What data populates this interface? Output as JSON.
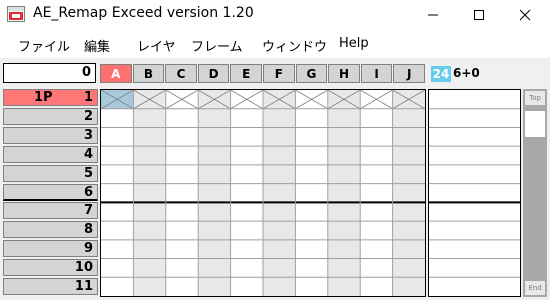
{
  "window": {
    "title": "AE_Remap Exceed version 1.20",
    "icon": "app-icon",
    "controls": [
      "minimize-icon",
      "maximize-icon",
      "close-icon"
    ]
  },
  "menu": [
    "ファイル",
    "編集",
    "レイヤ",
    "フレーム",
    "ウィンドウ",
    "Help"
  ],
  "toolbar": {
    "frame_value": "0",
    "columns": [
      "A",
      "B",
      "C",
      "D",
      "E",
      "F",
      "G",
      "H",
      "I",
      "J"
    ],
    "selected_column": "A",
    "fps": "24",
    "koma": "6+0"
  },
  "rows": [
    {
      "label": "1P",
      "num": "1"
    },
    {
      "label": "",
      "num": "2"
    },
    {
      "label": "",
      "num": "3"
    },
    {
      "label": "",
      "num": "4"
    },
    {
      "label": "",
      "num": "5"
    },
    {
      "label": "",
      "num": "6"
    },
    {
      "label": "",
      "num": "7"
    },
    {
      "label": "",
      "num": "8"
    },
    {
      "label": "",
      "num": "9"
    },
    {
      "label": "",
      "num": "10"
    },
    {
      "label": "",
      "num": "11"
    }
  ],
  "scrollbar": {
    "top_label": "Top",
    "end_label": "End"
  },
  "colors": {
    "selected_col_header": "#ff7070",
    "fps_badge": "#66ccee",
    "row_header_bg": "#d4d4d4",
    "current_row_bg": "#ff7777",
    "cell_shade": "#e8e8e8",
    "selected_cell": "#a8c8dc"
  }
}
